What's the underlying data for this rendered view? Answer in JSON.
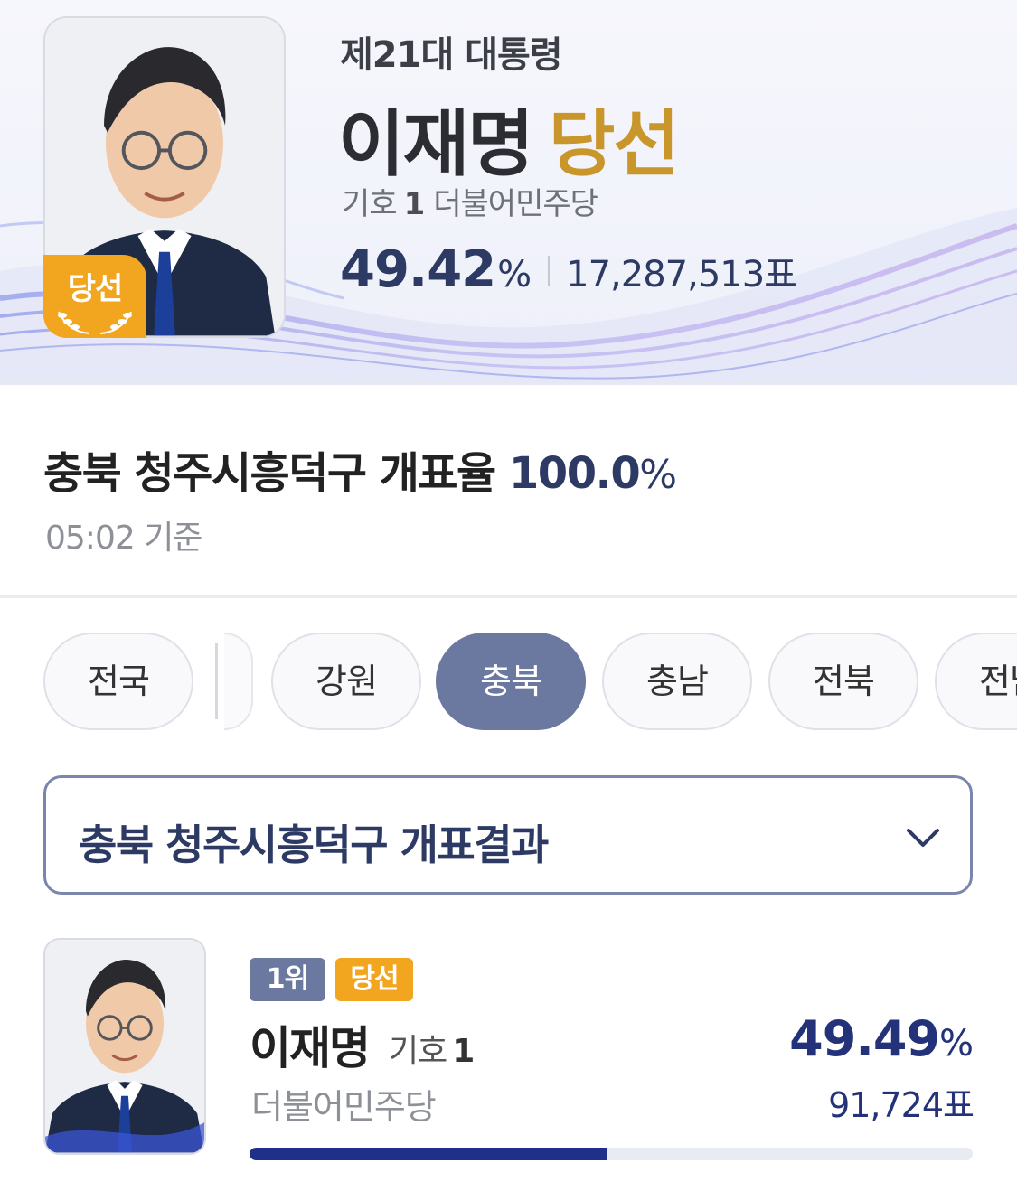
{
  "hero": {
    "subtitle": "제21대 대통령",
    "name": "이재명",
    "result": "당선",
    "symbol_label": "기호",
    "symbol_number": "1",
    "party": "더불어민주당",
    "percent": "49.42",
    "percent_unit": "%",
    "votes": "17,287,513표",
    "badge": "당선"
  },
  "region": {
    "title": "충북 청주시흥덕구 개표율",
    "rate": "100.0",
    "rate_unit": "%",
    "time": "05:02 기준"
  },
  "tabs": [
    {
      "label": "전국",
      "active": false
    },
    {
      "label": "강원",
      "active": false
    },
    {
      "label": "충북",
      "active": true
    },
    {
      "label": "충남",
      "active": false
    },
    {
      "label": "전북",
      "active": false
    },
    {
      "label": "전남",
      "active": false
    }
  ],
  "dropdown": {
    "label": "충북 청주시흥덕구 개표결과"
  },
  "candidates": [
    {
      "rank": "1위",
      "status": "당선",
      "name": "이재명",
      "symbol_label": "기호",
      "symbol_number": "1",
      "party": "더불어민주당",
      "percent": "49.49",
      "percent_unit": "%",
      "votes": "91,724표",
      "share": 0.4949
    }
  ],
  "colors": {
    "accent_navy": "#2d3a64",
    "tab_active": "#6b789f",
    "winner_gold": "#c8962a",
    "badge_orange": "#f2a51f",
    "bar_fill": "#1f2f8a"
  },
  "icons": {
    "dropdown": "chevron-down-icon",
    "badge": "laurel-icon"
  }
}
